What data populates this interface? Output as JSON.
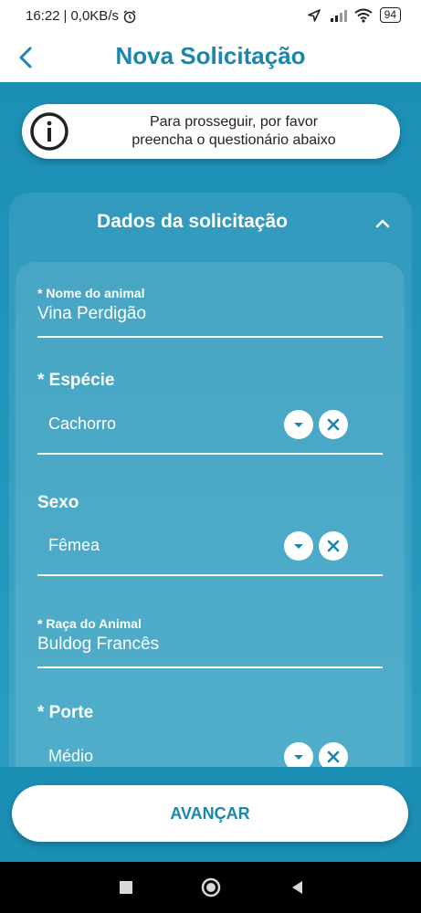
{
  "status_bar": {
    "time": "16:22",
    "network_speed": "0,0KB/s",
    "battery": "94",
    "icons": [
      "alarm-icon",
      "location-icon",
      "signal-icon",
      "wifi-icon",
      "battery-icon"
    ]
  },
  "app_bar": {
    "title": "Nova Solicitação",
    "back_icon": "chevron-left-icon"
  },
  "info_banner": {
    "icon": "info-icon",
    "line1": "Para prosseguir, por favor",
    "line2": "preencha o questionário abaixo"
  },
  "section": {
    "title": "Dados da solicitação",
    "collapse_icon": "chevron-up-icon",
    "fields": {
      "animal_name": {
        "label": "* Nome do animal",
        "value": "Vina Perdigão"
      },
      "species": {
        "label": "* Espécie",
        "value": "Cachorro"
      },
      "sex": {
        "label": "Sexo",
        "value": "Fêmea"
      },
      "breed": {
        "label": "* Raça do Animal",
        "value": "Buldog Francês"
      },
      "size": {
        "label": "* Porte",
        "value": "Médio"
      }
    }
  },
  "actions": {
    "next_label": "AVANÇAR"
  },
  "colors": {
    "brand": "#1a86ad",
    "background": "#1e8fb3",
    "surface": "#ffffff"
  }
}
